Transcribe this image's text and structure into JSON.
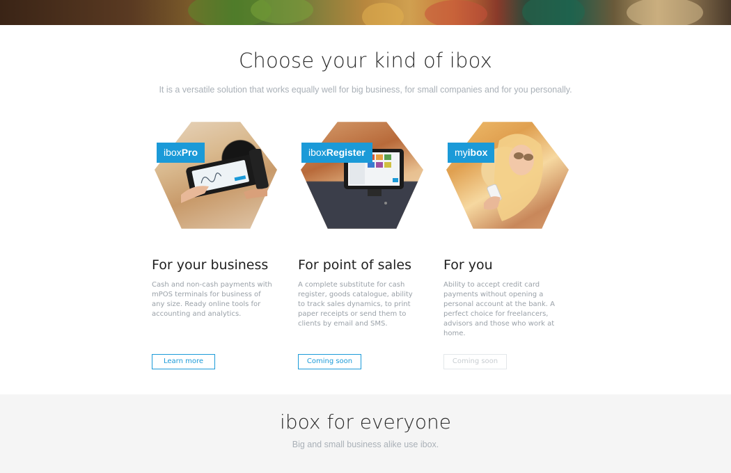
{
  "header_image": {
    "alt": ""
  },
  "choose": {
    "title": "Choose your kind of ibox",
    "subtitle": "It is a versatile solution that works equally well for big business, for small companies and for you personally."
  },
  "cards": [
    {
      "tag_prefix": "ibox",
      "tag_bold": "Pro",
      "title": "For your business",
      "description": "Cash and non-cash payments with mPOS terminals for business of any size. Ready online tools for accounting and analytics.",
      "button": "Learn more",
      "button_enabled": true,
      "image_icon": "mpos-terminal-photo"
    },
    {
      "tag_prefix": "ibox",
      "tag_bold": "Register",
      "title": "For point of sales",
      "description": "A complete substitute for cash register, goods catalogue, ability to track sales dynamics, to print paper receipts or send them to clients by email and SMS.",
      "button": "Coming soon",
      "button_enabled": true,
      "image_icon": "pos-register-photo"
    },
    {
      "tag_prefix": "my",
      "tag_bold": "ibox",
      "title": "For you",
      "description": "Ability to accept credit card payments without opening a personal account at the bank. A perfect choice for freelancers, advisors and those who work at home.",
      "button": "Coming soon",
      "button_enabled": false,
      "image_icon": "woman-with-phone-photo"
    }
  ],
  "everyone": {
    "title": "ibox for everyone",
    "subtitle": "Big and small business alike use ibox."
  },
  "colors": {
    "accent": "#1b9ad8",
    "muted_text": "#9aa1a8",
    "band_bg": "#f5f5f5"
  }
}
